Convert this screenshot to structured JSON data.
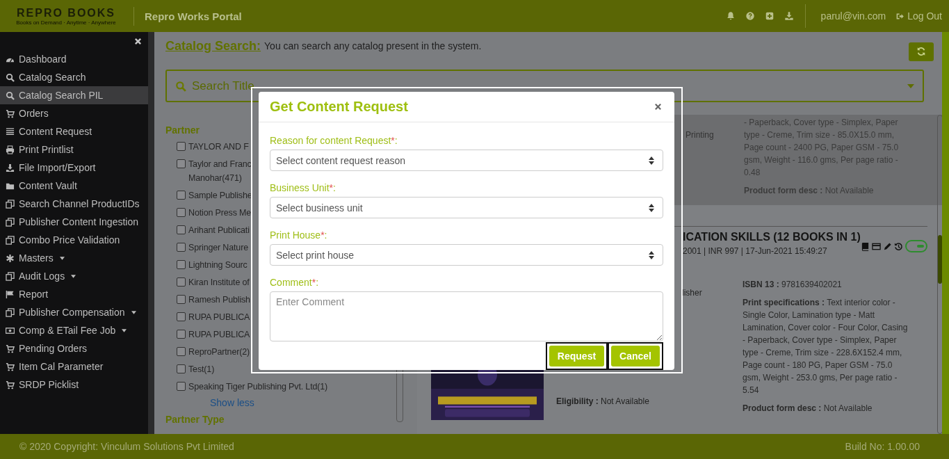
{
  "header": {
    "logo": "REPRO BOOKS",
    "tagline": "Books on Demand · Anytime · Anywhere",
    "portal_title": "Repro Works Portal",
    "user_email": "parul@vin.com",
    "logout": "Log Out"
  },
  "sidebar": {
    "items": [
      {
        "label": "Dashboard",
        "selected": false,
        "has_submenu": false
      },
      {
        "label": "Catalog Search",
        "selected": false,
        "has_submenu": false
      },
      {
        "label": "Catalog Search PIL",
        "selected": true,
        "has_submenu": false
      },
      {
        "label": "Orders",
        "selected": false,
        "has_submenu": false
      },
      {
        "label": "Content Request",
        "selected": false,
        "has_submenu": false
      },
      {
        "label": "Print Printlist",
        "selected": false,
        "has_submenu": false
      },
      {
        "label": "File Import/Export",
        "selected": false,
        "has_submenu": false
      },
      {
        "label": "Content Vault",
        "selected": false,
        "has_submenu": false
      },
      {
        "label": "Search Channel ProductIDs",
        "selected": false,
        "has_submenu": false
      },
      {
        "label": "Publisher Content Ingestion",
        "selected": false,
        "has_submenu": false
      },
      {
        "label": "Combo Price Validation",
        "selected": false,
        "has_submenu": false
      },
      {
        "label": "Masters",
        "selected": false,
        "has_submenu": true
      },
      {
        "label": "Audit Logs",
        "selected": false,
        "has_submenu": true
      },
      {
        "label": "Report",
        "selected": false,
        "has_submenu": false
      },
      {
        "label": "Publisher Compensation",
        "selected": false,
        "has_submenu": true
      },
      {
        "label": "Comp & ETail Fee Job",
        "selected": false,
        "has_submenu": true
      },
      {
        "label": "Pending Orders",
        "selected": false,
        "has_submenu": false
      },
      {
        "label": "Item Cal Parameter",
        "selected": false,
        "has_submenu": false
      },
      {
        "label": "SRDP Picklist",
        "selected": false,
        "has_submenu": false
      }
    ]
  },
  "page": {
    "title": "Catalog Search:",
    "description": "You can search any catalog present in the system.",
    "search": {
      "placeholder": "Search Title"
    }
  },
  "filters": {
    "heading": "Partner",
    "partners": [
      {
        "lines": [
          "TAYLOR AND F"
        ],
        "checked": false
      },
      {
        "lines": [
          "Taylor and Franc",
          "Manohar(471)"
        ],
        "checked": false
      },
      {
        "lines": [
          "Sample Publishe"
        ],
        "checked": false
      },
      {
        "lines": [
          "Notion Press Me"
        ],
        "checked": false
      },
      {
        "lines": [
          "Arihant Publicati"
        ],
        "checked": false
      },
      {
        "lines": [
          "Springer Nature"
        ],
        "checked": false
      },
      {
        "lines": [
          "Lightning Sourc"
        ],
        "checked": false
      },
      {
        "lines": [
          "Kiran Institute of"
        ],
        "checked": false
      },
      {
        "lines": [
          "Ramesh Publish"
        ],
        "checked": false
      },
      {
        "lines": [
          "RUPA PUBLICA"
        ],
        "checked": false
      },
      {
        "lines": [
          "RUPA PUBLICA"
        ],
        "checked": false
      },
      {
        "lines": [
          "ReproPartner(2)"
        ],
        "checked": false
      },
      {
        "lines": [
          "Test(1)"
        ],
        "checked": false
      },
      {
        "lines": [
          "Speaking Tiger Publishing Pvt. Ltd(1)"
        ],
        "checked": false
      }
    ],
    "show_less": "Show less",
    "next_heading": "Partner Type"
  },
  "results": [
    {
      "fragment": "Printing",
      "specs": "- Paperback, Cover type - Simplex, Paper type - Creme, Trim size - 85.0X15.0 mm, Page count - 2400 PG, Paper GSM - 75.0 gsm, Weight - 116.0 gms, Per page ratio - 0.48",
      "form_label": "Product form desc :",
      "form_value": "Not Available"
    },
    {
      "title": "ICATION SKILLS (12 BOOKS IN 1)",
      "meta": "2001 | INR 997 | 17-Jun-2021 15:49:27",
      "active": true,
      "fragment": "lisher",
      "eligibility_label": "Eligibility :",
      "eligibility_value": "Not Available",
      "isbn_label": "ISBN 13 :",
      "isbn_value": "9781639402021",
      "specs_label": "Print specifications :",
      "specs": "Text interior color - Single Color, Lamination type - Matt Lamination, Cover color - Four Color, Casing - Paperback, Cover type - Simplex, Paper type - Creme, Trim size - 228.6X152.4 mm, Page count - 180 PG, Paper GSM - 75.0 gsm, Weight - 253.0 gms, Per page ratio - 5.54",
      "form_label": "Product form desc :",
      "form_value": "Not Available"
    }
  ],
  "modal": {
    "title": "Get Content Request",
    "fields": [
      {
        "kind": "select",
        "label": "Reason for content Request",
        "required_mark": "*",
        "suffix": ":",
        "placeholder": "Select content request reason"
      },
      {
        "kind": "select",
        "label": "Business Unit",
        "required_mark": "*",
        "suffix": ":",
        "placeholder": "Select business unit"
      },
      {
        "kind": "select",
        "label": "Print House",
        "required_mark": "*",
        "suffix": ":",
        "placeholder": "Select print house"
      },
      {
        "kind": "textarea",
        "label": "Comment",
        "required_mark": "*",
        "suffix": ":",
        "placeholder": "Enter Comment"
      }
    ],
    "buttons": [
      "Request",
      "Cancel"
    ]
  },
  "footer": {
    "copyright": "© 2020 Copyright: Vinculum Solutions Pvt Limited",
    "build": "Build No: 1.00.00"
  }
}
